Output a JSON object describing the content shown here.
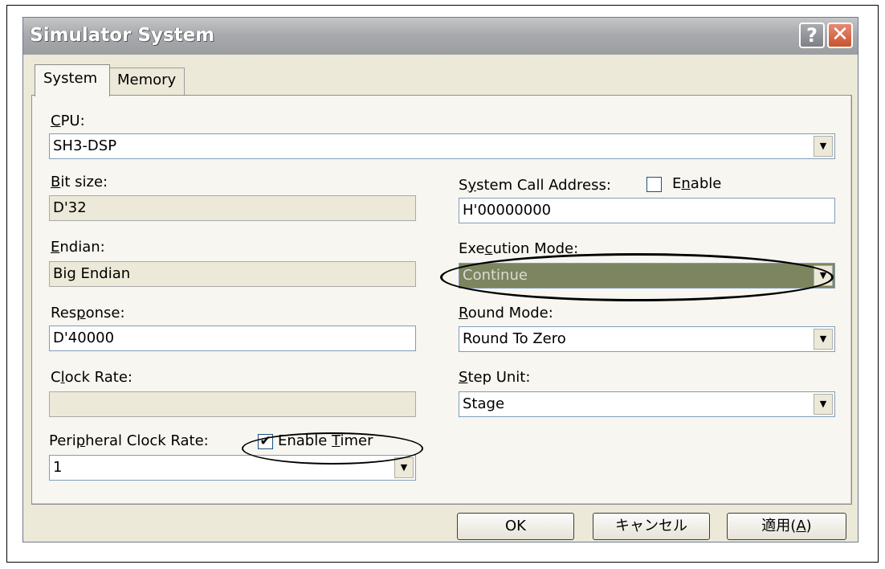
{
  "dialog": {
    "title": "Simulator System",
    "help_glyph": "?",
    "close_glyph": "✕"
  },
  "tabs": [
    {
      "label": "System",
      "selected": true
    },
    {
      "label": "Memory",
      "selected": false
    }
  ],
  "cpu": {
    "label_mnemonic": "C",
    "label_rest": "PU:",
    "value": "SH3-DSP"
  },
  "bit_size": {
    "label_mnemonic": "B",
    "label_rest": "it size:",
    "value": "D'32"
  },
  "endian": {
    "label_mnemonic": "E",
    "label_rest": "ndian:",
    "value": "Big Endian"
  },
  "response": {
    "label_pre": "Res",
    "label_mnemonic": "p",
    "label_post": "onse:",
    "value": "D'40000"
  },
  "clock_rate": {
    "label_pre": "C",
    "label_mnemonic": "l",
    "label_post": "ock Rate:",
    "value": ""
  },
  "peripheral_clock_rate": {
    "label_pre": "Peri",
    "label_mnemonic": "p",
    "label_post": "heral Clock Rate:",
    "value": "1",
    "enable_timer": {
      "label_pre": "Enable ",
      "label_mnemonic": "T",
      "label_post": "imer",
      "checked": true,
      "check_glyph": "✔"
    }
  },
  "system_call_address": {
    "label_pre": "S",
    "label_mnemonic": "y",
    "label_post": "stem Call Address:",
    "value": "H'00000000",
    "enable": {
      "label_pre": "E",
      "label_mnemonic": "n",
      "label_post": "able",
      "checked": false
    }
  },
  "execution_mode": {
    "label_pre": "Exe",
    "label_mnemonic": "c",
    "label_post": "ution Mode:",
    "value": "Continue"
  },
  "round_mode": {
    "label_mnemonic": "R",
    "label_rest": "ound Mode:",
    "value": "Round To Zero"
  },
  "step_unit": {
    "label_mnemonic": "S",
    "label_rest": "tep Unit:",
    "value": "Stage"
  },
  "dropdown_glyph": "▼",
  "buttons": {
    "ok": "OK",
    "cancel": "キャンセル",
    "apply_text": "適用(",
    "apply_mnemonic": "A",
    "apply_close": ")"
  },
  "colors": {
    "dialog_bg": "#ece9d8",
    "selection_bg": "#7c8560",
    "close_button": "#c8542f"
  }
}
